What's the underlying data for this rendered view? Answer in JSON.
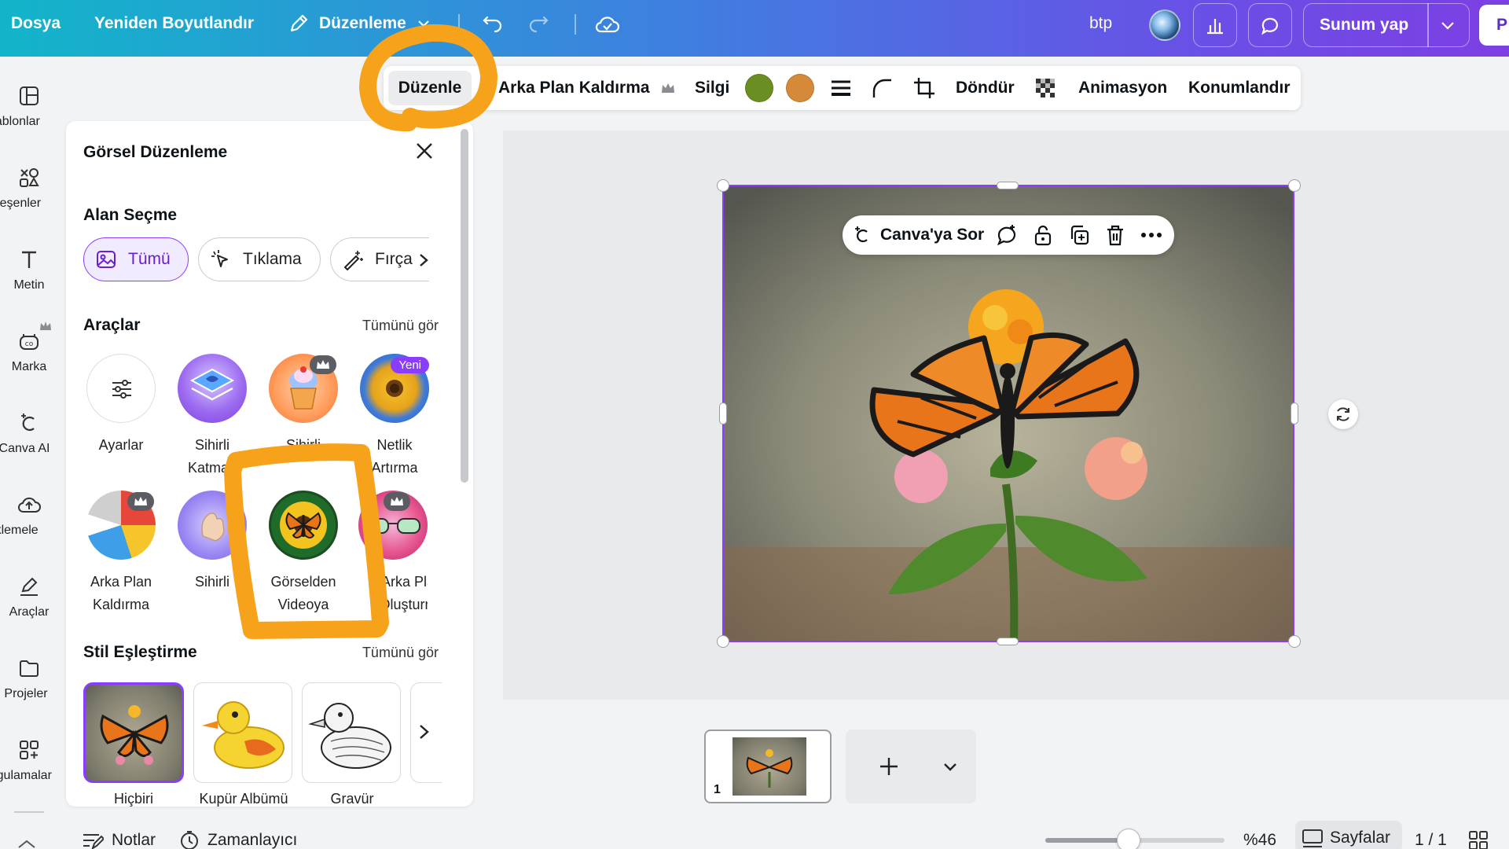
{
  "topbar": {
    "file": "Dosya",
    "resize": "Yeniden Boyutlandır",
    "edit_mode": "Düzenleme",
    "user": "btp",
    "present": "Sunum yap",
    "share_partial": "P"
  },
  "rail": [
    {
      "label": "Şablonlar"
    },
    {
      "label": "Bileşenler"
    },
    {
      "label": "Metin"
    },
    {
      "label": "Marka"
    },
    {
      "label": "Canva AI"
    },
    {
      "label": "Yüklemeler"
    },
    {
      "label": "Araçlar"
    },
    {
      "label": "Projeler"
    },
    {
      "label": "Uygulamalar"
    }
  ],
  "context_toolbar": {
    "edit": "Düzenle",
    "bg_remove": "Arka Plan Kaldırma",
    "eraser": "Silgi",
    "colors": [
      "#6b8e23",
      "#d58a3a"
    ],
    "rotate": "Döndür",
    "animate": "Animasyon",
    "position": "Konumlandır"
  },
  "panel": {
    "title": "Görsel Düzenleme",
    "area_section": "Alan Seçme",
    "chips": [
      "Tümü",
      "Tıklama",
      "Fırça"
    ],
    "tools_section": "Araçlar",
    "see_all": "Tümünü gör",
    "tools": [
      {
        "line1": "Ayarlar",
        "line2": ""
      },
      {
        "line1": "Sihirli",
        "line2": "Katman"
      },
      {
        "line1": "Sihirli",
        "line2": ""
      },
      {
        "line1": "Netlik",
        "line2": "Artırma",
        "badge": "Yeni"
      },
      {
        "line1": "Arka Plan",
        "line2": "Kaldırma"
      },
      {
        "line1": "Sihirli",
        "line2": ""
      },
      {
        "line1": "Görselden",
        "line2": "Videoya"
      },
      {
        "line1": "Arka Plan",
        "line2": "Oluşturma"
      }
    ],
    "style_section": "Stil Eşleştirme",
    "style_see_all": "Tümünü gör",
    "styles": [
      "Hiçbiri",
      "Kupür Albümü",
      "Gravür"
    ]
  },
  "canvas": {
    "ask_canva": "Canva'ya Sor"
  },
  "pages": {
    "thumb_number": "1"
  },
  "bottom": {
    "notes": "Notlar",
    "timer": "Zamanlayıcı",
    "zoom": "%46",
    "zoom_level": 0.46,
    "pages_label": "Sayfalar",
    "page_count": "1 / 1"
  },
  "accent": "#8b3dff",
  "annotation_color": "#f7a21b"
}
